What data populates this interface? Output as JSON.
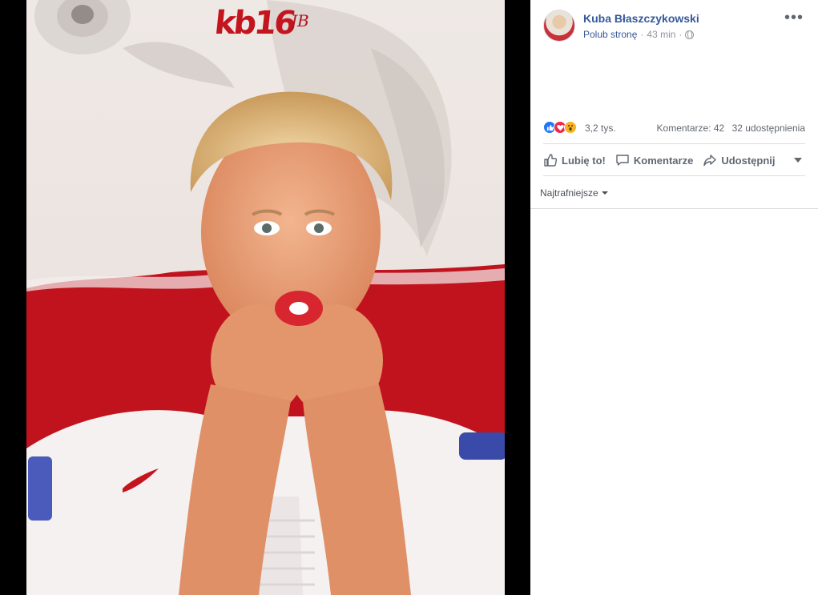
{
  "photo": {
    "logo_text": "kb16",
    "signature_text": "JB"
  },
  "post": {
    "author": "Kuba Błaszczykowski",
    "like_page": "Polub stronę",
    "separator": "·",
    "time": "43 min",
    "menu": "•••"
  },
  "reactions": {
    "icons": [
      "like-icon",
      "love-icon",
      "wow-icon"
    ],
    "count": "3,2 tys.",
    "comments": "Komentarze: 42",
    "shares": "32 udostępnienia"
  },
  "actions": {
    "like": "Lubię to!",
    "comment": "Komentarze",
    "share": "Udostępnij"
  },
  "sort": {
    "label": "Najtrafniejsze"
  },
  "colors": {
    "link": "#365899",
    "muted": "#90949c",
    "like_blue": "#2078f4",
    "love_red": "#f0284a",
    "wow_yellow": "#f7b125",
    "flag_red": "#c4151f"
  }
}
